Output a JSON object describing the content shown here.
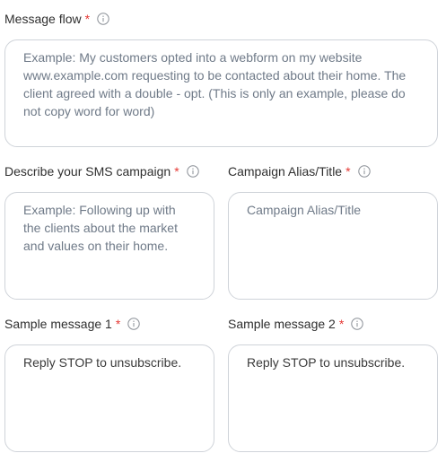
{
  "fields": {
    "message_flow": {
      "label": "Message flow",
      "required_mark": "*",
      "value": "",
      "placeholder": "Example: My customers opted into a webform on my website www.example.com requesting to be contacted about their home. The client agreed with a double - opt. (This is only an example, please do not copy word for word)"
    },
    "sms_campaign": {
      "label": "Describe your SMS campaign",
      "required_mark": "*",
      "value": "",
      "placeholder": "Example: Following up with the clients about the market and values on their home."
    },
    "campaign_alias": {
      "label": "Campaign Alias/Title",
      "required_mark": "*",
      "value": "",
      "placeholder": "Campaign Alias/Title"
    },
    "sample_message_1": {
      "label": "Sample message 1",
      "required_mark": "*",
      "value": "Reply STOP to unsubscribe.",
      "placeholder": ""
    },
    "sample_message_2": {
      "label": "Sample message 2",
      "required_mark": "*",
      "value": "Reply STOP to unsubscribe.",
      "placeholder": ""
    }
  },
  "icons": {
    "info": "info-circle-icon"
  },
  "colors": {
    "required": "#e53935",
    "border": "#cfd3d9",
    "placeholder": "#6f7a88"
  }
}
